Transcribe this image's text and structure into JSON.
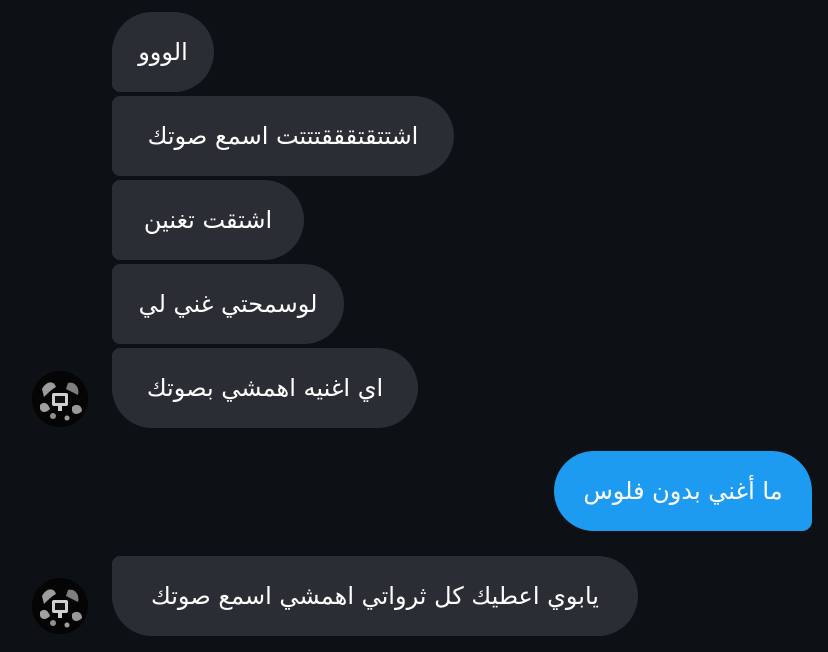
{
  "conversation": {
    "messages": [
      {
        "text": "الووو",
        "sender": "other"
      },
      {
        "text": "اشتتقتقققتتتت اسمع صوتك",
        "sender": "other"
      },
      {
        "text": "اشتقت تغنين",
        "sender": "other"
      },
      {
        "text": "لوسمحتي غني لي",
        "sender": "other"
      },
      {
        "text": "اي اغنيه اهمشي بصوتك",
        "sender": "other"
      },
      {
        "text": "ما أغني بدون فلوس",
        "sender": "self"
      },
      {
        "text": "يابوي اعطيك كل ثرواتي اهمشي اسمع صوتك",
        "sender": "other"
      }
    ]
  },
  "colors": {
    "background": "#0d1014",
    "incoming_bubble": "#2a2d33",
    "outgoing_bubble": "#1d9bf0",
    "text": "#ffffff"
  },
  "icons": {
    "avatar": "avatar-icon"
  }
}
